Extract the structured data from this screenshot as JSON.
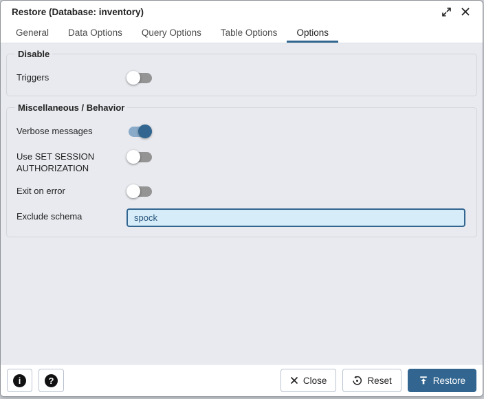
{
  "window": {
    "title": "Restore (Database: inventory)",
    "expand_icon": "expand-icon",
    "close_icon": "close-icon"
  },
  "tabs": [
    {
      "label": "General",
      "active": ""
    },
    {
      "label": "Data Options",
      "active": ""
    },
    {
      "label": "Query Options",
      "active": ""
    },
    {
      "label": "Table Options",
      "active": ""
    },
    {
      "label": "Options",
      "active": "active"
    }
  ],
  "sections": [
    {
      "legend": "Disable",
      "rows": [
        {
          "label": "Triggers",
          "control": "toggle",
          "state": "off"
        }
      ]
    },
    {
      "legend": "Miscellaneous / Behavior",
      "rows": [
        {
          "label": "Verbose messages",
          "control": "toggle",
          "state": "on"
        },
        {
          "label": "Use SET SESSION AUTHORIZATION",
          "control": "toggle",
          "state": "off"
        },
        {
          "label": "Exit on error",
          "control": "toggle",
          "state": "off"
        },
        {
          "label": "Exclude schema",
          "control": "text-input",
          "value": "spock"
        }
      ]
    }
  ],
  "footer": {
    "info_glyph": "i",
    "help_glyph": "?",
    "close_label": "Close",
    "reset_label": "Reset",
    "restore_label": "Restore"
  },
  "colors": {
    "primary": "#326690",
    "toggle_on_track": "#89aac8",
    "toggle_off_track": "#949494",
    "input_bg": "#d7ecf9",
    "content_bg": "#e8eaef"
  }
}
